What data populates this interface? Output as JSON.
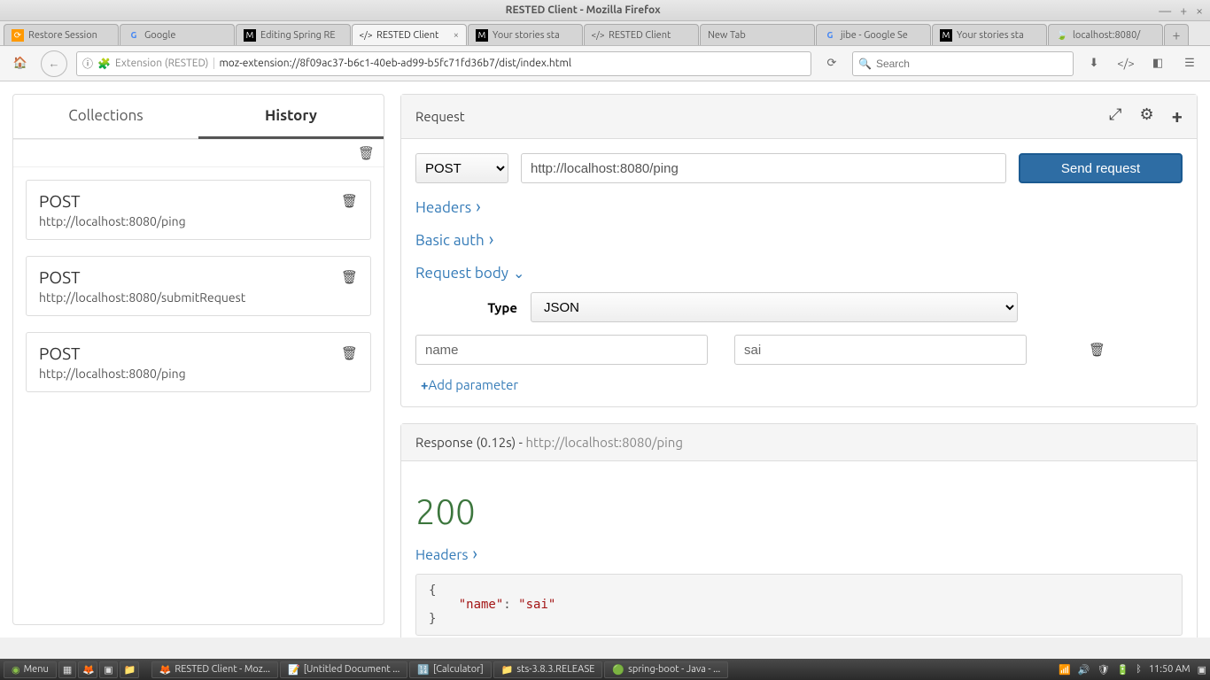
{
  "window": {
    "title": "RESTED Client - Mozilla Firefox"
  },
  "tabs": [
    {
      "label": "Restore Session",
      "icon": "⟳"
    },
    {
      "label": "Google",
      "icon": "G"
    },
    {
      "label": "Editing Spring RE",
      "icon": "M"
    },
    {
      "label": "RESTED Client",
      "icon": "</>",
      "active": true
    },
    {
      "label": "Your stories sta",
      "icon": "M"
    },
    {
      "label": "RESTED Client",
      "icon": "</>"
    },
    {
      "label": "New Tab",
      "icon": ""
    },
    {
      "label": "jibe - Google Se",
      "icon": "G"
    },
    {
      "label": "Your stories sta",
      "icon": "M"
    },
    {
      "label": "localhost:8080/",
      "icon": "🍃"
    }
  ],
  "urlbar": {
    "ext_label": "Extension (RESTED)",
    "url": "moz-extension://8f09ac37-b6c1-40eb-ad99-b5fc71fd36b7/dist/index.html",
    "search_placeholder": "Search"
  },
  "sidebar": {
    "tabs": {
      "collections": "Collections",
      "history": "History"
    },
    "items": [
      {
        "method": "POST",
        "url": "http://localhost:8080/ping"
      },
      {
        "method": "POST",
        "url": "http://localhost:8080/submitRequest"
      },
      {
        "method": "POST",
        "url": "http://localhost:8080/ping"
      }
    ]
  },
  "request": {
    "title": "Request",
    "method": "POST",
    "url": "http://localhost:8080/ping",
    "send_label": "Send request",
    "headers_label": "Headers",
    "basicauth_label": "Basic auth",
    "body_label": "Request body",
    "type_label": "Type",
    "type_value": "JSON",
    "param_key": "name",
    "param_val": "sai",
    "add_param": "Add parameter"
  },
  "response": {
    "title_prefix": "Response (0.12s) - ",
    "title_url": "http://localhost:8080/ping",
    "status": "200",
    "headers_label": "Headers",
    "body_line1": "{",
    "body_key": "\"name\"",
    "body_colon": ": ",
    "body_val": "\"sai\"",
    "body_line3": "}"
  },
  "taskbar": {
    "menu": "Menu",
    "items": [
      "RESTED Client - Moz...",
      "[Untitled Document ...",
      "[Calculator]",
      "sts-3.8.3.RELEASE",
      "spring-boot - Java - ..."
    ],
    "time": "11:50 AM"
  }
}
